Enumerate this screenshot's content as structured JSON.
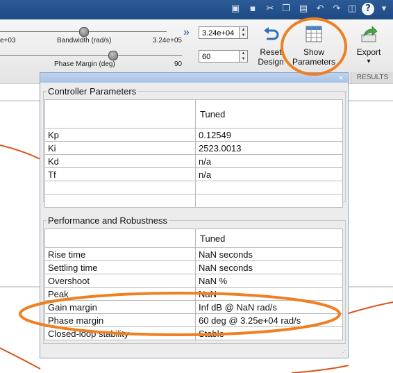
{
  "quick_access": {
    "icons": [
      "select-tool-icon",
      "save-icon",
      "cut-icon",
      "copy-icon",
      "paste-icon",
      "undo-icon",
      "redo-icon",
      "switch-windows-icon"
    ],
    "help": "?",
    "dropdown": "▾"
  },
  "toolstrip": {
    "bandwidth": {
      "label": "Bandwidth (rad/s)",
      "min": "e+03",
      "max": "3.24e+05",
      "value": "3.24e+04",
      "level": 0.5
    },
    "phase_margin": {
      "label": "Phase Margin (deg)",
      "max": "90",
      "value": "60",
      "level": 0.62
    },
    "arrow": "»",
    "reset_button": {
      "line1": "Reset",
      "line2": "Design"
    },
    "show_parameters_button": {
      "line1": "Show",
      "line2": "Parameters"
    },
    "export_button": {
      "label": "Export",
      "arrow": "▾"
    },
    "results_label": "RESULTS"
  },
  "parameters_window": {
    "close": "×",
    "controller_parameters": {
      "title": "Controller Parameters",
      "column_header": "Tuned",
      "rows": [
        {
          "name": "Kp",
          "value": "0.12549"
        },
        {
          "name": "Ki",
          "value": "2523.0013"
        },
        {
          "name": "Kd",
          "value": "n/a"
        },
        {
          "name": "Tf",
          "value": "n/a"
        },
        {
          "name": "",
          "value": ""
        },
        {
          "name": "",
          "value": ""
        }
      ]
    },
    "performance": {
      "title": "Performance and Robustness",
      "column_header": "Tuned",
      "rows": [
        {
          "name": "Rise time",
          "value": "NaN seconds"
        },
        {
          "name": "Settling time",
          "value": "NaN seconds"
        },
        {
          "name": "Overshoot",
          "value": "NaN %"
        },
        {
          "name": "Peak",
          "value": "NaN"
        },
        {
          "name": "Gain margin",
          "value": "Inf dB @ NaN rad/s"
        },
        {
          "name": "Phase margin",
          "value": "60 deg @ 3.25e+04 rad/s"
        },
        {
          "name": "Closed-loop stability",
          "value": "Stable"
        }
      ]
    }
  },
  "colors": {
    "highlight": "#f07f21",
    "curve": "#d9541a",
    "title_bar": "#1e4a83"
  }
}
